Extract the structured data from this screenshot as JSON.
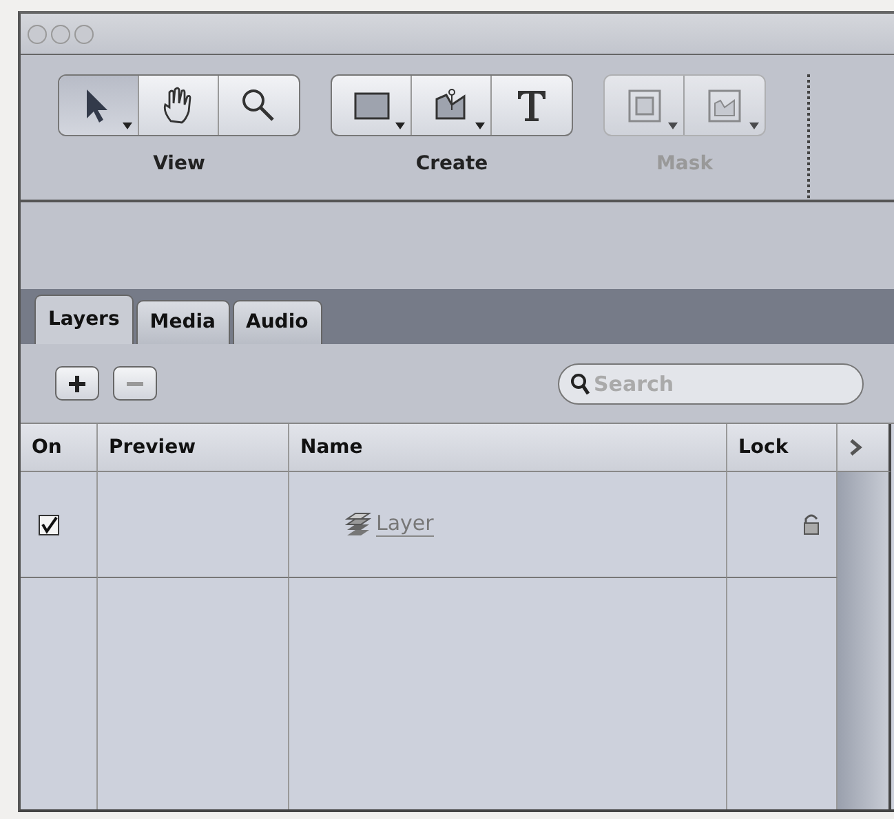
{
  "toolbar": [
    {
      "label": "View",
      "disabled": false,
      "tools": [
        {
          "kind": "arrow",
          "selected": true,
          "menu": true
        },
        {
          "kind": "hand",
          "selected": false,
          "menu": false
        },
        {
          "kind": "zoom",
          "selected": false,
          "menu": false
        }
      ]
    },
    {
      "label": "Create",
      "disabled": false,
      "tools": [
        {
          "kind": "rect",
          "selected": false,
          "menu": true
        },
        {
          "kind": "pen",
          "selected": false,
          "menu": true
        },
        {
          "kind": "text",
          "selected": false,
          "menu": false
        }
      ]
    },
    {
      "label": "Mask",
      "disabled": true,
      "tools": [
        {
          "kind": "rectmask",
          "selected": false,
          "menu": true
        },
        {
          "kind": "penmask",
          "selected": false,
          "menu": true
        }
      ]
    }
  ],
  "tabs": [
    {
      "label": "Layers",
      "selected": true
    },
    {
      "label": "Media",
      "selected": false
    },
    {
      "label": "Audio",
      "selected": false
    }
  ],
  "buttons": [
    {
      "kind": "add",
      "disabled": false
    },
    {
      "kind": "remove",
      "disabled": true
    }
  ],
  "search": {
    "placeholder": "Search"
  },
  "table": {
    "columns": [
      "On",
      "Preview",
      "Name",
      "Lock"
    ],
    "rows": [
      {
        "on": true,
        "name": "Layer",
        "locked": false
      }
    ]
  }
}
